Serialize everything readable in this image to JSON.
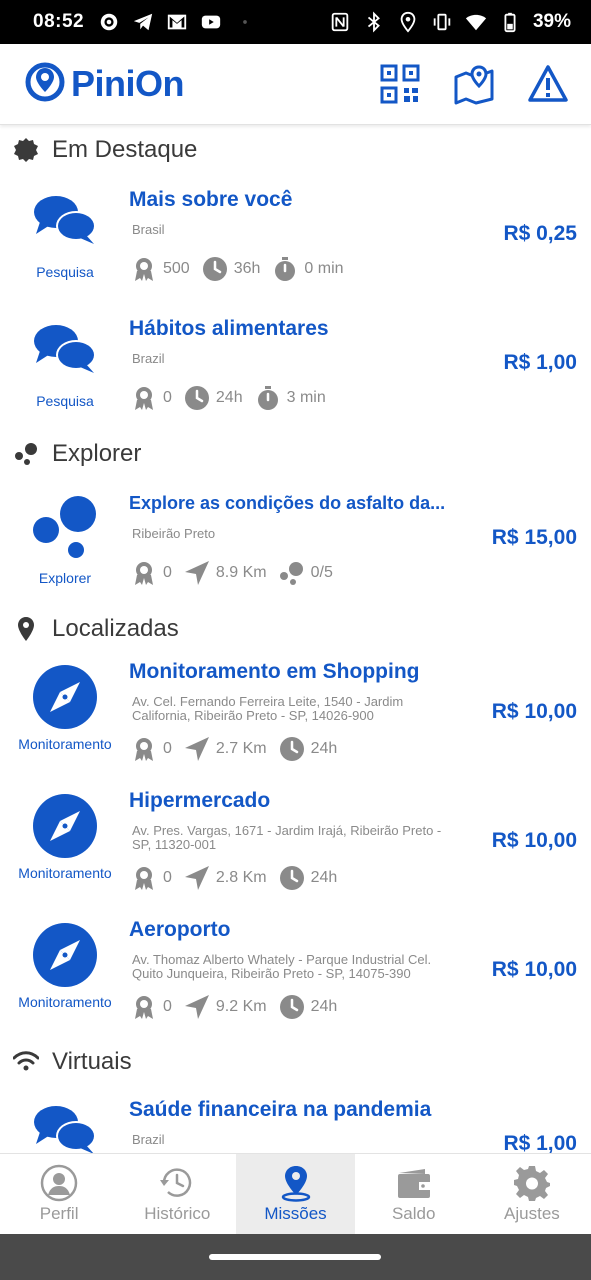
{
  "status": {
    "time": "08:52",
    "battery": "39%"
  },
  "app": {
    "logo_text": "PiniOn"
  },
  "sections": {
    "destaque": "Em Destaque",
    "explorer": "Explorer",
    "localizadas": "Localizadas",
    "virtuais": "Virtuais"
  },
  "missions": [
    {
      "type": "Pesquisa",
      "title": "Mais sobre você",
      "location": "Brasil",
      "s1": "500",
      "s2": "36h",
      "s3": "0 min",
      "price": "R$ 0,25"
    },
    {
      "type": "Pesquisa",
      "title": "Hábitos alimentares",
      "location": "Brazil",
      "s1": "0",
      "s2": "24h",
      "s3": "3 min",
      "price": "R$ 1,00"
    },
    {
      "type": "Explorer",
      "title": "Explore as condições do asfalto da...",
      "location": "Ribeirão Preto",
      "s1": "0",
      "s2": "8.9 Km",
      "s3": "0/5",
      "price": "R$ 15,00"
    },
    {
      "type": "Monitoramento",
      "title": "Monitoramento em Shopping",
      "location": "Av. Cel. Fernando Ferreira Leite, 1540 - Jardim California, Ribeirão Preto - SP, 14026-900",
      "s1": "0",
      "s2": "2.7 Km",
      "s3": "24h",
      "price": "R$ 10,00"
    },
    {
      "type": "Monitoramento",
      "title": "Hipermercado",
      "location": "Av. Pres. Vargas, 1671 - Jardim Irajá, Ribeirão Preto - SP, 11320-001",
      "s1": "0",
      "s2": "2.8 Km",
      "s3": "24h",
      "price": "R$ 10,00"
    },
    {
      "type": "Monitoramento",
      "title": "Aeroporto",
      "location": "Av. Thomaz Alberto Whately - Parque Industrial Cel. Quito Junqueira, Ribeirão Preto - SP, 14075-390",
      "s1": "0",
      "s2": "9.2 Km",
      "s3": "24h",
      "price": "R$ 10,00"
    },
    {
      "type": "",
      "title": "Saúde financeira na pandemia",
      "location": "Brazil",
      "price": "R$ 1,00"
    }
  ],
  "nav": {
    "perfil": "Perfil",
    "historico": "Histórico",
    "missoes": "Missões",
    "saldo": "Saldo",
    "ajustes": "Ajustes"
  },
  "colors": {
    "brand_blue": "#1357c6",
    "stat_gray": "#8a8a8a"
  }
}
